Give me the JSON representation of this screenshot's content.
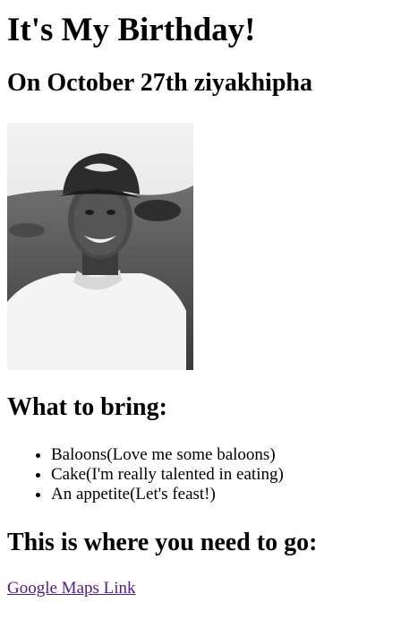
{
  "page": {
    "title": "It's My Birthday!",
    "subtitle": "On October 27th ziyakhipha",
    "photo_alt": "Portrait of a smiling young man wearing a cap",
    "bring_heading": "What to bring:",
    "bring_items": [
      "Baloons(Love me some baloons)",
      "Cake(I'm really talented in eating)",
      "An appetite(Let's feast!)"
    ],
    "go_heading": "This is where you need to go:",
    "map_link_label": "Google Maps Link"
  },
  "colors": {
    "text": "#000000",
    "visited_link": "#551a8b",
    "background": "#ffffff"
  }
}
